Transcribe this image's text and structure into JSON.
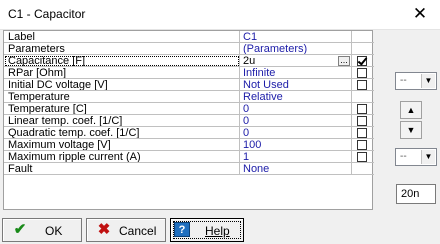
{
  "window": {
    "title": "C1 - Capacitor",
    "close_glyph": "✕"
  },
  "grid": {
    "header": {
      "name": "Label",
      "value": "C1"
    },
    "rows": [
      {
        "name": "Parameters",
        "value": "(Parameters)",
        "check": null
      },
      {
        "name": "Capacitance  [F]",
        "value": "2u",
        "check": true,
        "active": true
      },
      {
        "name": "RPar      [Ohm]",
        "value": "Infinite",
        "check": false
      },
      {
        "name": "Initial DC voltage  [V]",
        "value": "Not Used",
        "check": false
      },
      {
        "name": "Temperature",
        "value": "Relative",
        "check": null
      },
      {
        "name": "Temperature [C]",
        "value": "0",
        "check": false
      },
      {
        "name": "Linear temp. coef. [1/C]",
        "value": "0",
        "check": false
      },
      {
        "name": "Quadratic temp. coef. [1/C]",
        "value": "0",
        "check": false
      },
      {
        "name": "Maximum voltage [V]",
        "value": "100",
        "check": false
      },
      {
        "name": "Maximum ripple current (A)",
        "value": "1",
        "check": false
      },
      {
        "name": "Fault",
        "value": "None",
        "check": null
      }
    ],
    "ellipsis": "..."
  },
  "side_panel": {
    "combo1_value": "--",
    "combo2_value": "--",
    "spin_up": "▲",
    "spin_down": "▼",
    "field_value": "20n"
  },
  "buttons": {
    "ok": "OK",
    "cancel": "Cancel",
    "help": "Help",
    "help_glyph": "?"
  },
  "colors": {
    "value_text": "#1c1ca8",
    "ok_check": "#1a8a1a",
    "cancel_x": "#c01010"
  }
}
